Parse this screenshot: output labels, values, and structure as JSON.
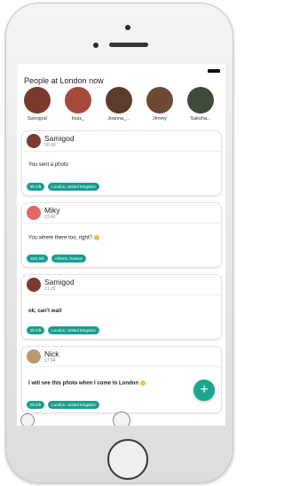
{
  "header": {
    "title": "People at London now"
  },
  "people": [
    {
      "name": "Samigod",
      "color": "#7a3b2e"
    },
    {
      "name": "louis_",
      "color": "#a64a3f"
    },
    {
      "name": "Joanna_...",
      "color": "#5a3d2c"
    },
    {
      "name": "Jimmy",
      "color": "#6d4a35"
    },
    {
      "name": "Saksha...",
      "color": "#3e4b38"
    }
  ],
  "posts": [
    {
      "name": "Samigod",
      "time": "00:09",
      "message": "You sent a photo",
      "bold": false,
      "tags": [
        "9h left",
        "London, United Kingdom"
      ],
      "avatar_color": "#7a3b2e"
    },
    {
      "name": "Miky",
      "time": "23:42",
      "message": "You where there too, right?",
      "bold": false,
      "tags": [
        "11m left",
        "Athens, Greece"
      ],
      "avatar_color": "#e06a6a"
    },
    {
      "name": "Samigod",
      "time": "21:29",
      "message": "ok, can't wait",
      "bold": true,
      "tags": [
        "3h left",
        "London, United Kingdom"
      ],
      "avatar_color": "#7a3b2e"
    },
    {
      "name": "Nick",
      "time": "17:04",
      "message": "I will see this photo when I come to London",
      "bold": true,
      "tags": [
        "5h left",
        "London, United Kingdom"
      ],
      "avatar_color": "#b99a70"
    }
  ],
  "fab": {
    "label": "+"
  }
}
